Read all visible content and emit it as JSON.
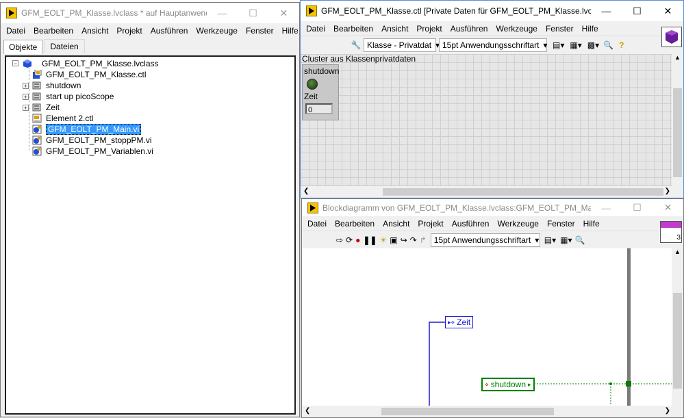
{
  "left_window": {
    "title": "GFM_EOLT_PM_Klasse.lvclass * auf Hauptanwendungsi...",
    "menu": [
      "Datei",
      "Bearbeiten",
      "Ansicht",
      "Projekt",
      "Ausführen",
      "Werkzeuge",
      "Fenster",
      "Hilfe"
    ],
    "tabs": [
      "Objekte",
      "Dateien"
    ],
    "tree": {
      "root": "GFM_EOLT_PM_Klasse.lvclass",
      "items": [
        {
          "label": "GFM_EOLT_PM_Klasse.ctl",
          "icon": "ctl-class-icon"
        },
        {
          "label": "shutdown",
          "icon": "folder-icon"
        },
        {
          "label": "start up picoScope",
          "icon": "folder-icon"
        },
        {
          "label": "Zeit",
          "icon": "folder-icon"
        },
        {
          "label": "Element 2.ctl",
          "icon": "ctl-icon"
        },
        {
          "label": "GFM_EOLT_PM_Main.vi",
          "icon": "vi-icon",
          "selected": true
        },
        {
          "label": "GFM_EOLT_PM_stoppPM.vi",
          "icon": "vi-icon"
        },
        {
          "label": "GFM_EOLT_PM_Variablen.vi",
          "icon": "vi-icon"
        }
      ]
    }
  },
  "ctl_window": {
    "title": "GFM_EOLT_PM_Klasse.ctl [Private Daten für GFM_EOLT_PM_Klasse.lvclass]",
    "menu": [
      "Datei",
      "Bearbeiten",
      "Ansicht",
      "Projekt",
      "Ausführen",
      "Werkzeuge",
      "Fenster",
      "Hilfe"
    ],
    "class_dropdown": "Klasse - Privatdat",
    "font_dropdown": "15pt Anwendungsschriftart",
    "cluster_label": "Cluster aus Klassenprivatdaten",
    "shutdown_label": "shutdown",
    "zeit_label": "Zeit",
    "zeit_value": "0"
  },
  "bd_window": {
    "title": "Blockdiagramm von GFM_EOLT_PM_Klasse.lvclass:GFM_EOLT_PM_Main.vi *",
    "menu": [
      "Datei",
      "Bearbeiten",
      "Ansicht",
      "Projekt",
      "Ausführen",
      "Werkzeuge",
      "Fenster",
      "Hilfe"
    ],
    "font_dropdown": "15pt Anwendungsschriftart",
    "zeit_node": "Zeit",
    "shutdown_node": "shutdown",
    "corner_number": "3"
  },
  "colors": {
    "selection": "#3399ff",
    "accent_purple": "#6a1b9a",
    "wire_blue": "#1a1ad6",
    "wire_green": "#008000"
  }
}
